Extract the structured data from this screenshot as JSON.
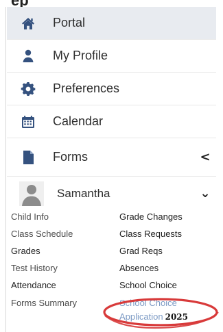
{
  "header": {
    "cut_text": "ep"
  },
  "menu": {
    "items": [
      {
        "label": "Portal",
        "icon": "home-icon"
      },
      {
        "label": "My Profile",
        "icon": "user-icon"
      },
      {
        "label": "Preferences",
        "icon": "gear-icon"
      },
      {
        "label": "Calendar",
        "icon": "calendar-icon"
      },
      {
        "label": "Forms",
        "icon": "document-icon"
      }
    ],
    "forms_chevron": "<",
    "student_name": "Samantha",
    "student_chevron": "⌄"
  },
  "links": {
    "child_info": "Child Info",
    "grade_changes": "Grade Changes",
    "class_schedule": "Class Schedule",
    "class_requests": "Class Requests",
    "grades": "Grades",
    "grad_reqs": "Grad Reqs",
    "test_history": "Test History",
    "absences": "Absences",
    "attendance": "Attendance",
    "school_choice": "School Choice",
    "forms_summary": "Forms Summary",
    "school_choice_application_line1": "School Choice",
    "school_choice_application_line2": "Application",
    "school_choice_application_year": "2025"
  },
  "colors": {
    "icon_blue": "#35527f",
    "active_bg": "#e8ebf0",
    "link_blue": "#7c9ac4",
    "highlight_circle": "#d83a3a"
  }
}
